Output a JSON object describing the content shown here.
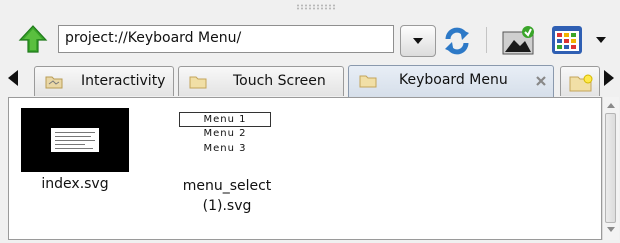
{
  "toolbar": {
    "up_icon": "up-arrow-icon",
    "path": "project://Keyboard Menu/",
    "dropdown_icon": "chevron-down-icon",
    "refresh_icon": "refresh-icon",
    "picture_icon": "picture-icon",
    "grid_icon": "grid-view-icon",
    "menu_icon": "chevron-down-icon"
  },
  "tabs": [
    {
      "label": "Interactivity",
      "icon": "folder-icon",
      "active": false
    },
    {
      "label": "Touch Screen",
      "icon": "folder-icon",
      "active": false
    },
    {
      "label": "Keyboard Menu",
      "icon": "folder-icon",
      "active": true
    }
  ],
  "files": [
    {
      "name": "index.svg"
    },
    {
      "name": "menu_select (1).svg",
      "line1": "menu_select",
      "line2": "(1).svg",
      "preview_items": [
        "Menu 1",
        "Menu 2",
        "Menu 3"
      ]
    }
  ],
  "colors": {
    "accent_green": "#3aa52a",
    "refresh_blue": "#2d79c7",
    "grid_blue": "#2f5fb3"
  }
}
